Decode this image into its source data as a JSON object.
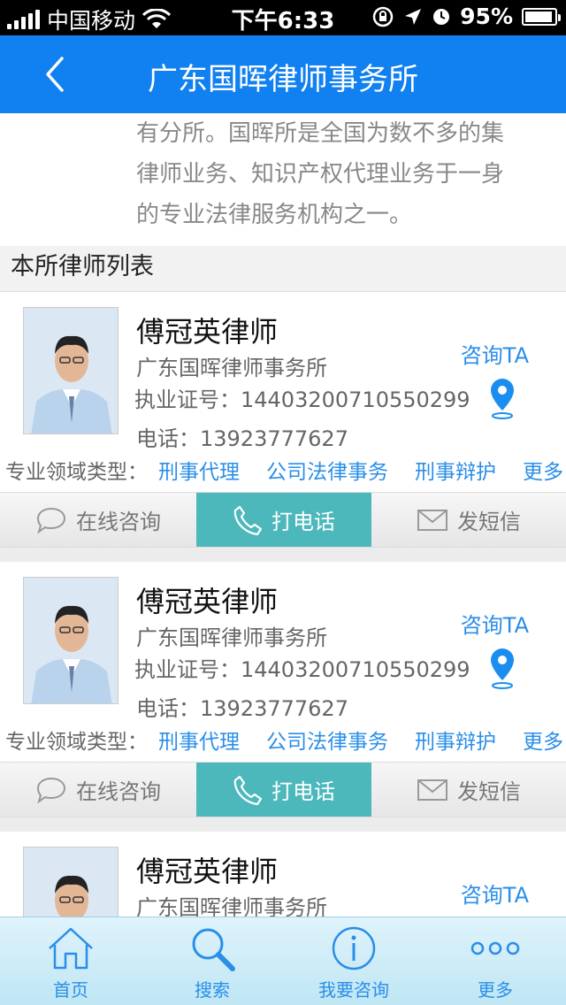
{
  "status_bar": {
    "carrier": "中国移动",
    "time": "下午6:33",
    "battery": "95%",
    "battery_level": 0.95
  },
  "nav": {
    "title": "广东国晖律师事务所"
  },
  "intro": {
    "lines": [
      "有分所。国晖所是全国为数不多的集",
      "律师业务、知识产权代理业务于一身",
      "的专业法律服务机构之一。"
    ]
  },
  "section": {
    "title": "本所律师列表"
  },
  "lawyers": [
    {
      "name": "傅冠英律师",
      "firm": "广东国晖律师事务所",
      "license": "执业证号：14403200710550299",
      "phone": "电话：13923777627",
      "consult": "咨询TA",
      "tags_label": "专业领域类型：",
      "tags": [
        "刑事代理",
        "公司法律事务",
        "刑事辩护"
      ],
      "more": "更多",
      "actions": {
        "chat": "在线咨询",
        "call": "打电话",
        "sms": "发短信"
      }
    },
    {
      "name": "傅冠英律师",
      "firm": "广东国晖律师事务所",
      "license": "执业证号：14403200710550299",
      "phone": "电话：13923777627",
      "consult": "咨询TA",
      "tags_label": "专业领域类型：",
      "tags": [
        "刑事代理",
        "公司法律事务",
        "刑事辩护"
      ],
      "more": "更多",
      "actions": {
        "chat": "在线咨询",
        "call": "打电话",
        "sms": "发短信"
      }
    },
    {
      "name": "傅冠英律师",
      "firm": "广东国晖律师事务所",
      "consult": "咨询TA"
    }
  ],
  "tabs": [
    {
      "label": "首页",
      "icon": "home-icon"
    },
    {
      "label": "搜索",
      "icon": "search-icon"
    },
    {
      "label": "我要咨询",
      "icon": "info-icon"
    },
    {
      "label": "更多",
      "icon": "more-dots-icon"
    }
  ],
  "colors": {
    "nav_bg": "#1180f0",
    "accent_blue": "#2a8ee8",
    "call_button": "#4cb8bc"
  }
}
